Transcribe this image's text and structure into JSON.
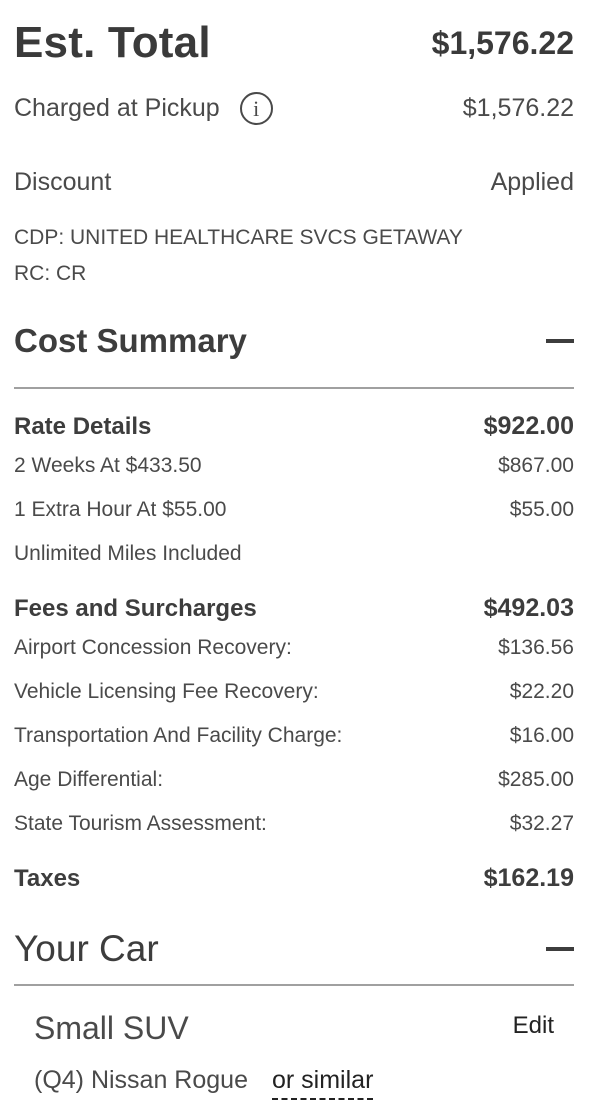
{
  "estimate": {
    "title": "Est. Total",
    "total": "$1,576.22",
    "charged_label": "Charged at Pickup",
    "charged_value": "$1,576.22"
  },
  "discount": {
    "label": "Discount",
    "status": "Applied",
    "cdp": "CDP: UNITED HEALTHCARE SVCS GETAWAY",
    "rc": "RC: CR"
  },
  "cost_summary": {
    "title": "Cost Summary",
    "rate_details": {
      "title": "Rate Details",
      "total": "$922.00",
      "items": [
        {
          "label": "2 Weeks At $433.50",
          "value": "$867.00"
        },
        {
          "label": "1 Extra Hour At $55.00",
          "value": "$55.00"
        },
        {
          "label": "Unlimited Miles Included",
          "value": ""
        }
      ]
    },
    "fees": {
      "title": "Fees and Surcharges",
      "total": "$492.03",
      "items": [
        {
          "label": "Airport Concession Recovery:",
          "value": "$136.56"
        },
        {
          "label": "Vehicle Licensing Fee Recovery:",
          "value": "$22.20"
        },
        {
          "label": "Transportation And Facility Charge:",
          "value": "$16.00"
        },
        {
          "label": "Age Differential:",
          "value": "$285.00"
        },
        {
          "label": "State Tourism Assessment:",
          "value": "$32.27"
        }
      ]
    },
    "taxes": {
      "title": "Taxes",
      "total": "$162.19"
    }
  },
  "your_car": {
    "title": "Your Car",
    "type": "Small SUV",
    "edit_label": "Edit",
    "model": "(Q4) Nissan Rogue",
    "similar_label": "or similar"
  },
  "icons": {
    "info": "info-icon",
    "collapse": "minus-icon"
  }
}
